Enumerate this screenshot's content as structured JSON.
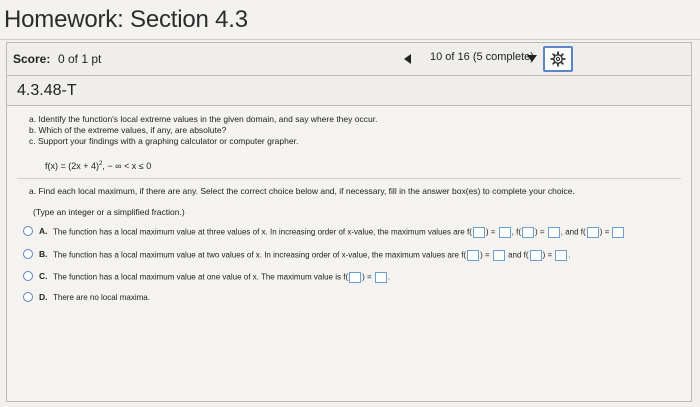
{
  "header": {
    "title": "Homework: Section 4.3"
  },
  "score": {
    "label": "Score:",
    "value": "0 of 1 pt"
  },
  "nav": {
    "progress": "10 of 16 (5 complete)"
  },
  "question": {
    "id": "4.3.48-T",
    "instructions": {
      "a": "a. Identify the function's local extreme values in the given domain, and say where they occur.",
      "b": "b. Which of the extreme values, if any, are absolute?",
      "c": "c. Support your findings with a graphing calculator or computer grapher."
    },
    "formula_main": "f(x) = (2x + 4)",
    "formula_exp": "2",
    "formula_domain": ", − ∞ < x ≤ 0",
    "part_a": "a. Find each local maximum, if there are any. Select the correct choice below and, if necessary, fill in the answer box(es) to complete your choice.",
    "hint": "(Type an integer or a simplified fraction.)",
    "choices": {
      "A": {
        "letter": "A.",
        "text": "The function has a local maximum value at three values of x. In increasing order of x-value, the maximum values are f",
        "and": "and f"
      },
      "B": {
        "letter": "B.",
        "text": "The function has a local maximum value at two values of x. In increasing order of x-value, the maximum values are f",
        "and": "and f"
      },
      "C": {
        "letter": "C.",
        "text": "The function has a local maximum value at one value of x. The maximum value is f"
      },
      "D": {
        "letter": "D.",
        "text": "There are no local maxima."
      }
    }
  },
  "colors": {
    "accent": "#5a86c8",
    "input_border": "#6aa0d8"
  },
  "icons": {
    "prev": "left-triangle",
    "dropdown": "down-triangle",
    "settings": "gear-icon"
  }
}
